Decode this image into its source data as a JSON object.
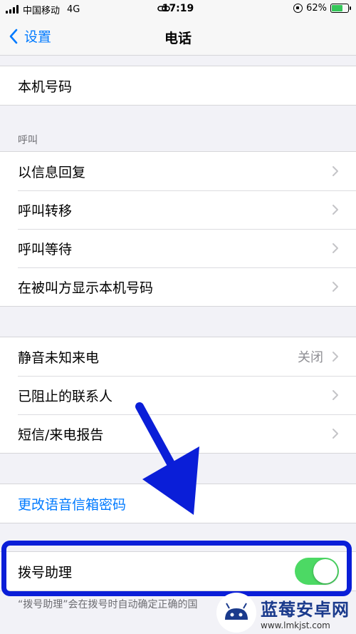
{
  "status_bar": {
    "carrier": "中国移动",
    "network": "4G",
    "time": "17:19",
    "battery": "62%"
  },
  "nav": {
    "back_label": "设置",
    "title": "电话"
  },
  "group1": {
    "items": [
      {
        "label": "本机号码"
      }
    ]
  },
  "calls_section": {
    "header": "呼叫",
    "items": [
      {
        "label": "以信息回复"
      },
      {
        "label": "呼叫转移"
      },
      {
        "label": "呼叫等待"
      },
      {
        "label": "在被叫方显示本机号码"
      }
    ]
  },
  "group3": {
    "items": [
      {
        "label": "静音未知来电",
        "value": "关闭"
      },
      {
        "label": "已阻止的联系人"
      },
      {
        "label": "短信/来电报告"
      }
    ]
  },
  "voicemail": {
    "label": "更改语音信箱密码"
  },
  "dial_assist": {
    "label": "拨号助理",
    "enabled": true,
    "footer": "“拨号助理”会在拨号时自动确定正确的国"
  },
  "watermark": {
    "title": "蓝莓安卓网",
    "url": "www.lmkjst.com"
  },
  "colors": {
    "accent": "#007aff",
    "toggle_on": "#4cd964",
    "annotation": "#0a1ed8"
  }
}
